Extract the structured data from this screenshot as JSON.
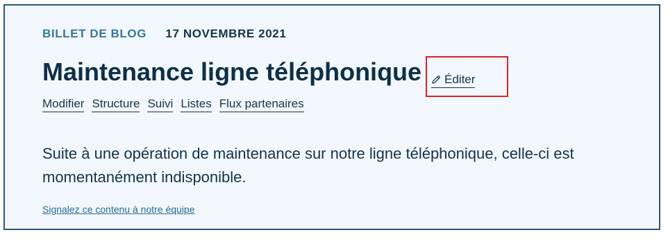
{
  "post": {
    "category": "BILLET DE BLOG",
    "date": "17 NOVEMBRE 2021",
    "title": "Maintenance ligne téléphonique",
    "edit_label": "Éditer",
    "edit_icon": "pencil-icon",
    "tabs": [
      {
        "label": "Modifier"
      },
      {
        "label": "Structure"
      },
      {
        "label": "Suivi"
      },
      {
        "label": "Listes"
      },
      {
        "label": "Flux partenaires"
      }
    ],
    "body": "Suite à une opération de maintenance sur notre ligne téléphonique, celle-ci est momentanément indisponible.",
    "report_link": "Signalez ce contenu à notre équipe"
  },
  "colors": {
    "card_background": "#f1f7fc",
    "card_border": "#2c5a72",
    "category": "#3a7699",
    "text": "#16324a",
    "highlight": "#d9222a"
  }
}
